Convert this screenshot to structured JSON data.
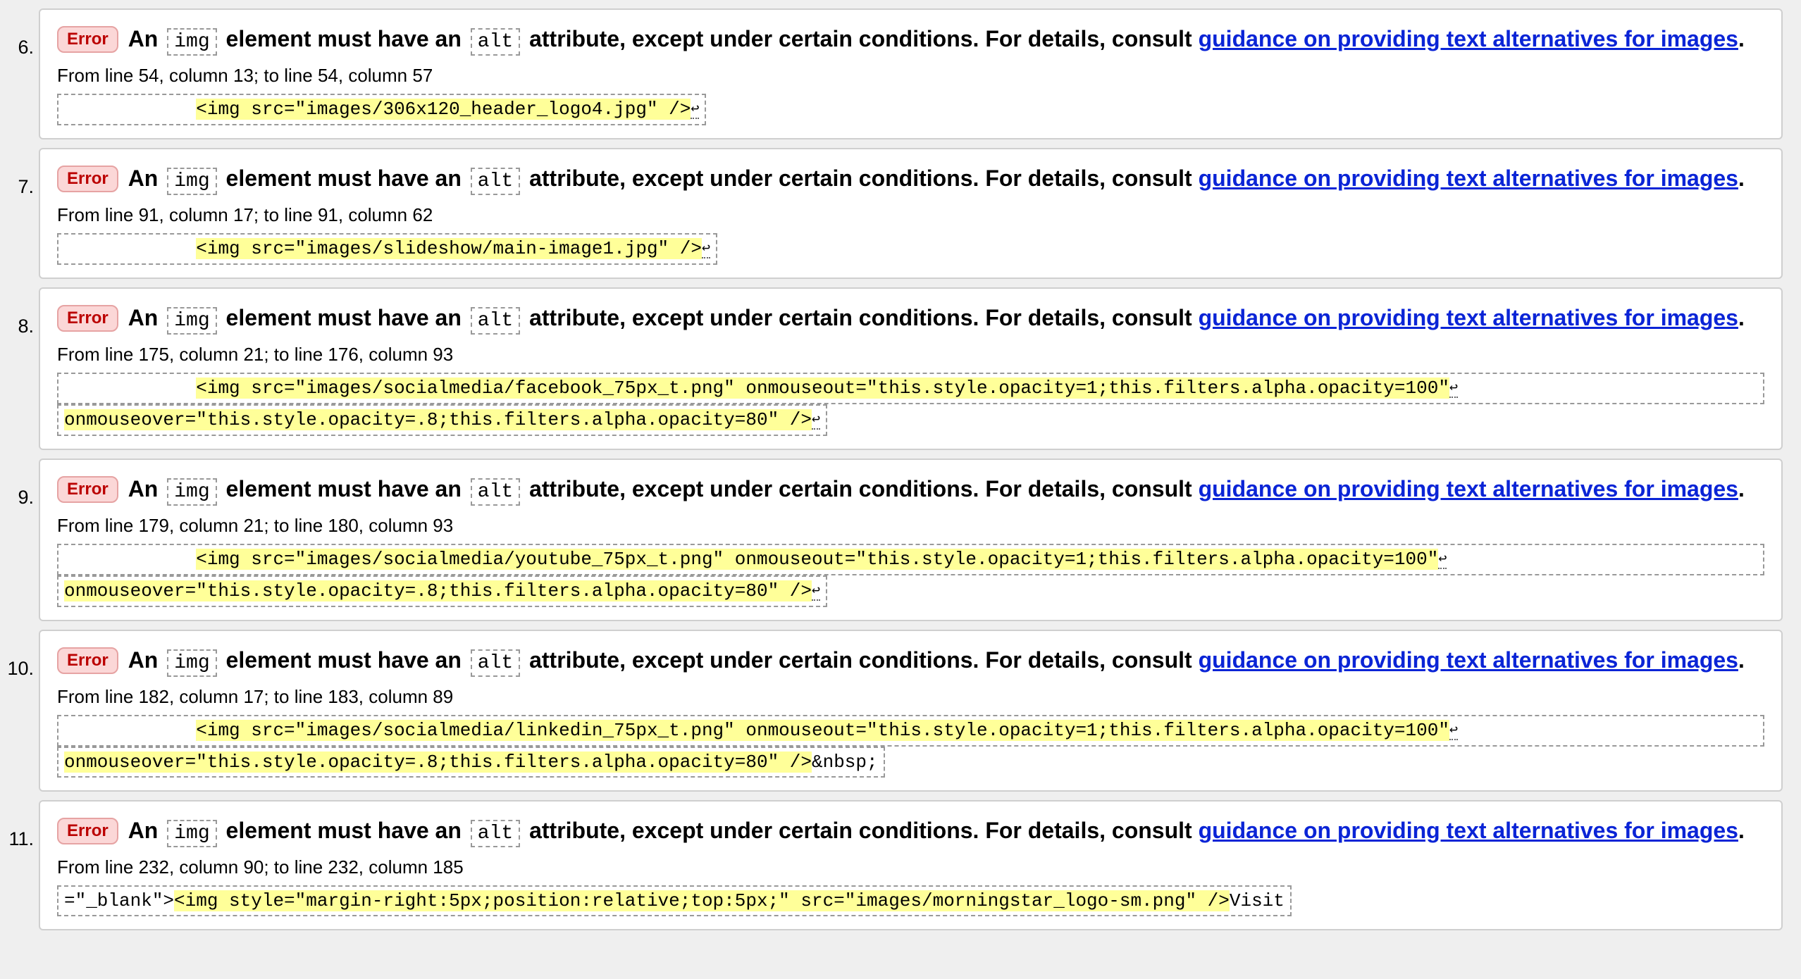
{
  "errors": [
    {
      "number": "6.",
      "badge": "Error",
      "msg_pre": "An",
      "code1": "img",
      "msg_mid": "element must have an",
      "code2": "alt",
      "msg_post": "attribute, except under certain conditions. For details, consult",
      "link": "guidance on providing text alternatives for images",
      "period": ".",
      "location": "From line 54, column 13; to line 54, column 57",
      "extract_lines": [
        {
          "pre": "            ",
          "hl": "<img src=\"images/306x120_header_logo4.jpg\" />",
          "post": ""
        }
      ]
    },
    {
      "number": "7.",
      "badge": "Error",
      "msg_pre": "An",
      "code1": "img",
      "msg_mid": "element must have an",
      "code2": "alt",
      "msg_post": "attribute, except under certain conditions. For details, consult",
      "link": "guidance on providing text alternatives for images",
      "period": ".",
      "location": "From line 91, column 17; to line 91, column 62",
      "extract_lines": [
        {
          "pre": "            ",
          "hl": "<img src=\"images/slideshow/main-image1.jpg\" />",
          "post": ""
        }
      ]
    },
    {
      "number": "8.",
      "badge": "Error",
      "msg_pre": "An",
      "code1": "img",
      "msg_mid": "element must have an",
      "code2": "alt",
      "msg_post": "attribute, except under certain conditions. For details, consult",
      "link": "guidance on providing text alternatives for images",
      "period": ".",
      "location": "From line 175, column 21; to line 176, column 93",
      "extract_lines": [
        {
          "pre": "            ",
          "hl": "<img src=\"images/socialmedia/facebook_75px_t.png\" onmouseout=\"this.style.opacity=1;this.filters.alpha.opacity=100\"",
          "post": ""
        },
        {
          "pre": "",
          "hl": "onmouseover=\"this.style.opacity=.8;this.filters.alpha.opacity=80\" />",
          "post": ""
        }
      ]
    },
    {
      "number": "9.",
      "badge": "Error",
      "msg_pre": "An",
      "code1": "img",
      "msg_mid": "element must have an",
      "code2": "alt",
      "msg_post": "attribute, except under certain conditions. For details, consult",
      "link": "guidance on providing text alternatives for images",
      "period": ".",
      "location": "From line 179, column 21; to line 180, column 93",
      "extract_lines": [
        {
          "pre": "            ",
          "hl": "<img src=\"images/socialmedia/youtube_75px_t.png\" onmouseout=\"this.style.opacity=1;this.filters.alpha.opacity=100\"",
          "post": ""
        },
        {
          "pre": "",
          "hl": "onmouseover=\"this.style.opacity=.8;this.filters.alpha.opacity=80\" />",
          "post": ""
        }
      ]
    },
    {
      "number": "10.",
      "badge": "Error",
      "msg_pre": "An",
      "code1": "img",
      "msg_mid": "element must have an",
      "code2": "alt",
      "msg_post": "attribute, except under certain conditions. For details, consult",
      "link": "guidance on providing text alternatives for images",
      "period": ".",
      "location": "From line 182, column 17; to line 183, column 89",
      "extract_lines": [
        {
          "pre": "            ",
          "hl": "<img src=\"images/socialmedia/linkedin_75px_t.png\" onmouseout=\"this.style.opacity=1;this.filters.alpha.opacity=100\"",
          "post": ""
        },
        {
          "pre": "",
          "hl": "onmouseover=\"this.style.opacity=.8;this.filters.alpha.opacity=80\" />",
          "post": "&nbsp;"
        }
      ]
    },
    {
      "number": "11.",
      "badge": "Error",
      "msg_pre": "An",
      "code1": "img",
      "msg_mid": "element must have an",
      "code2": "alt",
      "msg_post": "attribute, except under certain conditions. For details, consult",
      "link": "guidance on providing text alternatives for images",
      "period": ".",
      "location": "From line 232, column 90; to line 232, column 185",
      "extract_lines": [
        {
          "pre": "=\"_blank\">",
          "hl": "<img style=\"margin-right:5px;position:relative;top:5px;\" src=\"images/morningstar_logo-sm.png\" />",
          "post": "Visit"
        }
      ]
    }
  ],
  "return_symbol": "↩",
  "colors": {
    "badge_bg": "#fbd7d7",
    "badge_text": "#bb0000",
    "link": "#0a24d6",
    "highlight": "#ffff99",
    "page_bg": "#efefef"
  }
}
